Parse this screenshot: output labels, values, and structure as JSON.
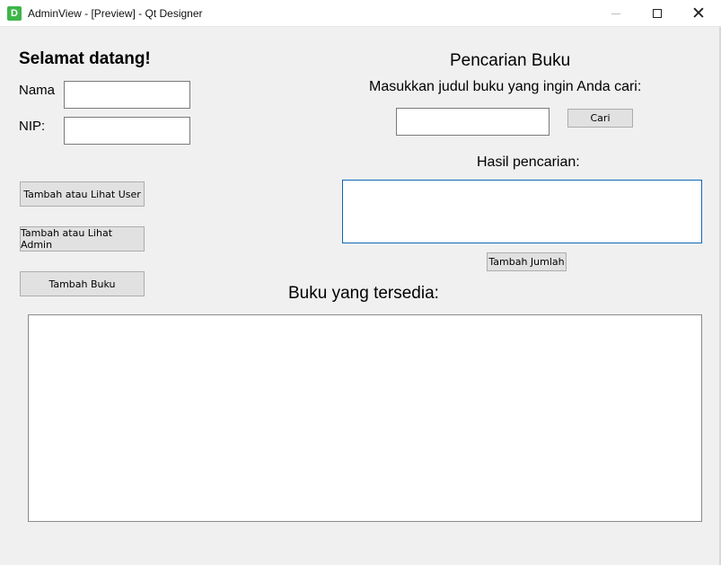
{
  "window": {
    "app_icon_letter": "D",
    "title": "AdminView - [Preview] - Qt Designer"
  },
  "icons": {
    "app": "qt-designer-icon",
    "minimize": "minimize-icon",
    "maximize": "maximize-icon",
    "close": "close-icon"
  },
  "left_panel": {
    "welcome": "Selamat datang!",
    "nama_label": "Nama:",
    "nama_value": "",
    "nip_label": "NIP:",
    "nip_value": "",
    "buttons": {
      "user": "Tambah atau Lihat User",
      "admin": "Tambah atau Lihat Admin",
      "buku": "Tambah Buku"
    }
  },
  "search_panel": {
    "title": "Pencarian Buku",
    "instruction": "Masukkan judul buku yang ingin Anda cari:",
    "query_value": "",
    "search_button": "Cari",
    "results_label": "Hasil pencarian:",
    "results_value": "",
    "add_quantity_button": "Tambah Jumlah"
  },
  "books_panel": {
    "label": "Buku yang tersedia:",
    "content": ""
  },
  "colors": {
    "window_bg": "#f0f0f0",
    "button_bg": "#e1e1e1",
    "focus_border": "#0f67b6",
    "app_icon": "#3fb54a"
  }
}
